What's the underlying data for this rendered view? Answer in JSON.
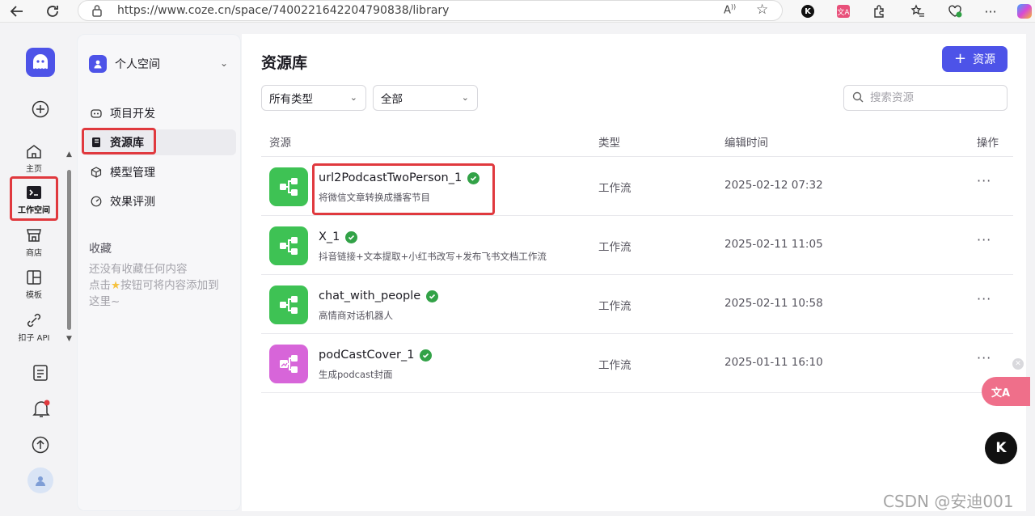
{
  "browser": {
    "url": "https://www.coze.cn/space/7400221642204790838/library",
    "back_icon": "arrow-left-icon",
    "reload_icon": "reload-icon"
  },
  "rail": {
    "items": [
      {
        "label": "主页",
        "icon": "home-icon"
      },
      {
        "label": "工作空间",
        "icon": "terminal-icon"
      },
      {
        "label": "商店",
        "icon": "store-icon"
      },
      {
        "label": "模板",
        "icon": "template-icon"
      },
      {
        "label": "扣子 API",
        "icon": "api-icon"
      }
    ]
  },
  "sidebar": {
    "space_label": "个人空间",
    "menu": [
      {
        "label": "项目开发",
        "icon": "robot-icon"
      },
      {
        "label": "资源库",
        "icon": "library-icon"
      },
      {
        "label": "模型管理",
        "icon": "cube-icon"
      },
      {
        "label": "效果评测",
        "icon": "gauge-icon"
      }
    ],
    "favorites_title": "收藏",
    "favorites_empty_1": "还没有收藏任何内容",
    "favorites_empty_2a": "点击",
    "favorites_empty_2b": "按钮可将内容添加到",
    "favorites_empty_3": "这里~"
  },
  "main": {
    "title": "资源库",
    "add_button": "资源",
    "filter_type": "所有类型",
    "filter_scope": "全部",
    "search_placeholder": "搜索资源",
    "columns": {
      "resource": "资源",
      "type": "类型",
      "edit_time": "编辑时间",
      "ops": "操作"
    },
    "rows": [
      {
        "name": "url2PodcastTwoPerson_1",
        "desc": "将微信文章转换成播客节目",
        "type": "工作流",
        "time": "2025-02-12 07:32",
        "color": "#3ec254"
      },
      {
        "name": "X_1",
        "desc": "抖音链接+文本提取+小红书改写+发布飞书文档工作流",
        "type": "工作流",
        "time": "2025-02-11 11:05",
        "color": "#3ec254"
      },
      {
        "name": "chat_with_people",
        "desc": "高情商对话机器人",
        "type": "工作流",
        "time": "2025-02-11 10:58",
        "color": "#3ec254"
      },
      {
        "name": "podCastCover_1",
        "desc": "生成podcast封面",
        "type": "工作流",
        "time": "2025-01-11 16:10",
        "color": "#d765d9"
      }
    ],
    "more": "···"
  },
  "floating": {
    "k_label": "K",
    "watermark": "CSDN @安迪001"
  },
  "colors": {
    "brand": "#4d53e8",
    "highlight": "#e0393e",
    "workflow_green": "#3ec254",
    "image_pink": "#d765d9"
  }
}
